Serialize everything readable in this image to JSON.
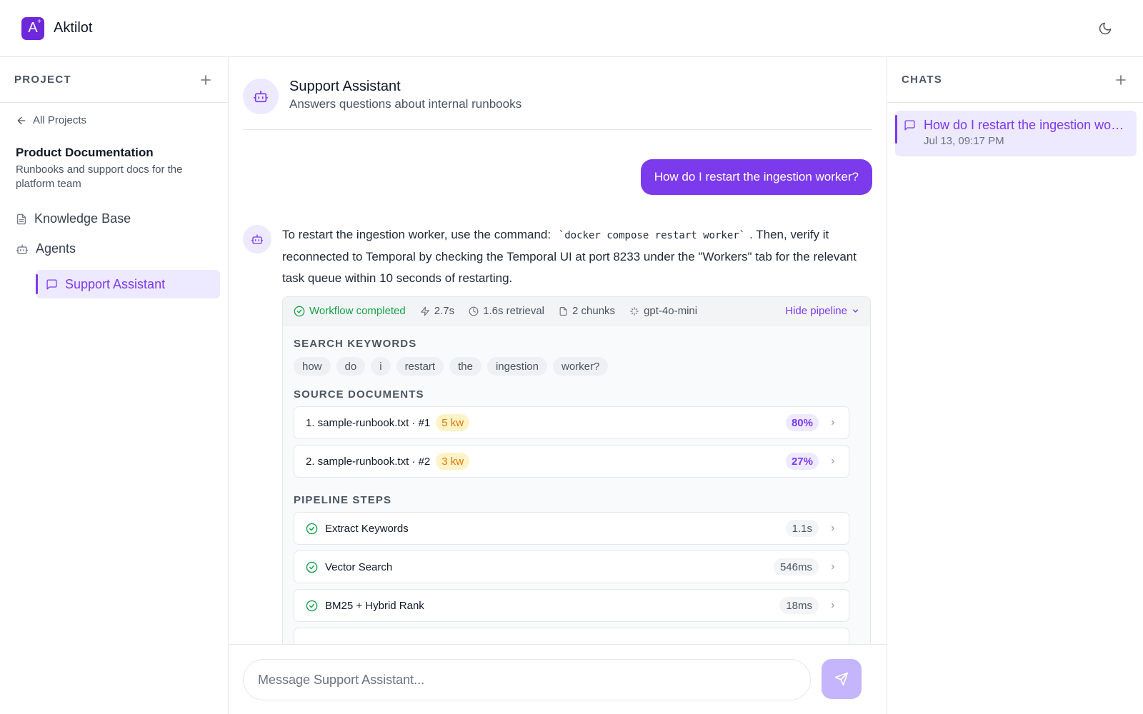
{
  "app": {
    "name": "Aktilot",
    "logo_letter": "A",
    "logo_plus": "+"
  },
  "colors": {
    "accent": "#7c3aed",
    "accent_light": "#ede9fe",
    "success": "#16a34a",
    "warning": "#d97706"
  },
  "icons": {
    "theme_toggle": "moon-icon"
  },
  "sidebar": {
    "heading": "PROJECT",
    "back_label": "All Projects",
    "project_title": "Product Documentation",
    "project_description": "Runbooks and support docs for the platform team",
    "nav": {
      "knowledge_base": "Knowledge Base",
      "agents": "Agents",
      "active_agent": "Support Assistant"
    }
  },
  "agent": {
    "name": "Support Assistant",
    "description": "Answers questions about internal runbooks"
  },
  "conversation": {
    "user_message": "How do I restart the ingestion worker?",
    "assistant": {
      "text_before": "To restart the ingestion worker, use the command:",
      "code": "`docker compose restart worker`",
      "text_after": ". Then, verify it reconnected to Temporal by checking the Temporal UI at port 8233 under the \"Workers\" tab for the relevant task queue within 10 seconds of restarting."
    }
  },
  "pipeline": {
    "status": "Workflow completed",
    "total_time": "2.7s",
    "retrieval": "1.6s retrieval",
    "chunks": "2 chunks",
    "model": "gpt-4o-mini",
    "toggle_label": "Hide pipeline",
    "keywords_label": "SEARCH KEYWORDS",
    "keywords": [
      "how",
      "do",
      "i",
      "restart",
      "the",
      "ingestion",
      "worker?"
    ],
    "sources_label": "SOURCE DOCUMENTS",
    "sources": [
      {
        "name": "1. sample-runbook.txt · #1",
        "kw": "5 kw",
        "score": "80%"
      },
      {
        "name": "2. sample-runbook.txt · #2",
        "kw": "3 kw",
        "score": "27%"
      }
    ],
    "steps_label": "PIPELINE STEPS",
    "steps": [
      {
        "name": "Extract Keywords",
        "duration": "1.1s"
      },
      {
        "name": "Vector Search",
        "duration": "546ms"
      },
      {
        "name": "BM25 + Hybrid Rank",
        "duration": "18ms"
      }
    ]
  },
  "composer": {
    "placeholder": "Message Support Assistant..."
  },
  "chats": {
    "heading": "CHATS",
    "items": [
      {
        "title": "How do I restart the ingestion worker?",
        "date": "Jul 13, 09:17 PM"
      }
    ]
  }
}
